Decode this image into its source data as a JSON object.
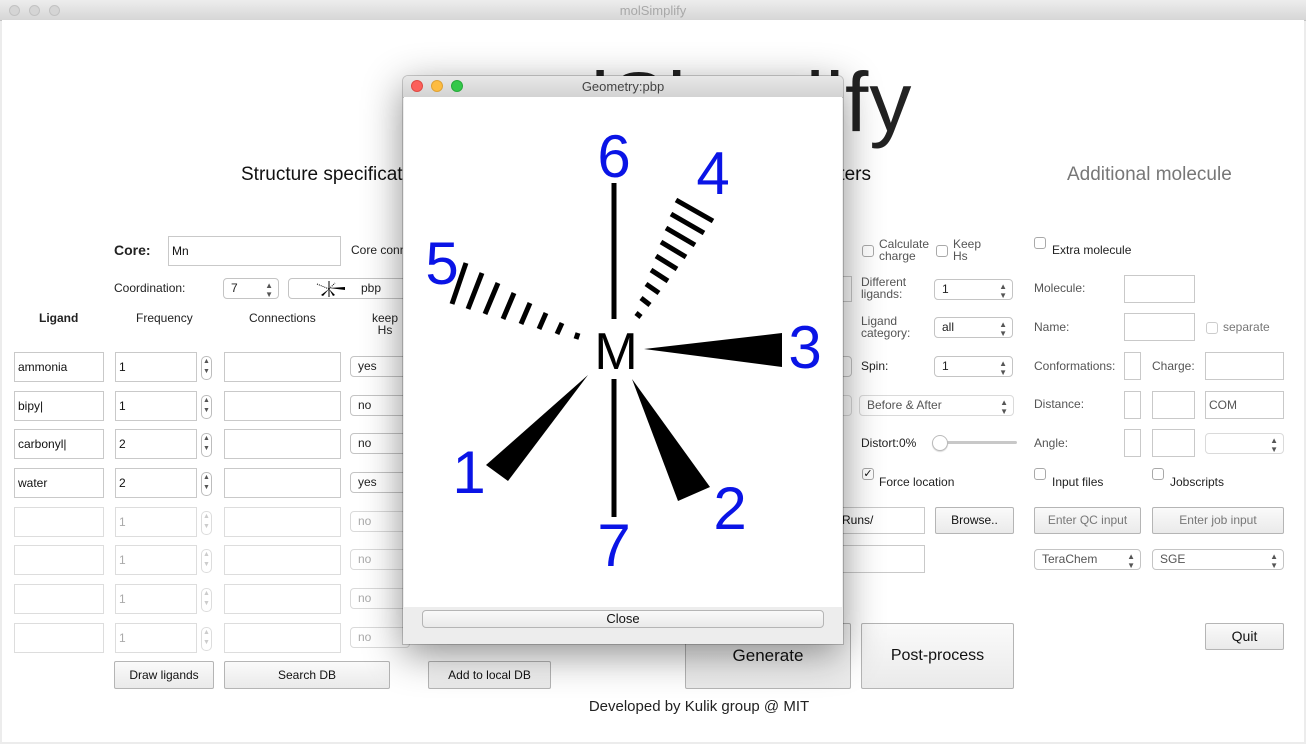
{
  "app": {
    "title": "molSimplify",
    "logo_text": "molSimplify"
  },
  "headings": {
    "structure": "Structure specification",
    "general": "General parameters",
    "additional": "Additional molecule"
  },
  "core": {
    "label": "Core:",
    "value": "Mn",
    "connection_label": "Core connection"
  },
  "coordination": {
    "label": "Coordination:",
    "value": "7",
    "geometry": "pbp"
  },
  "ligand_table": {
    "headers": {
      "ligand": "Ligand",
      "frequency": "Frequency",
      "connections": "Connections",
      "keep_hs": "keep Hs"
    },
    "rows": [
      {
        "ligand": "ammonia",
        "frequency": "1",
        "connections": "",
        "keep": "yes"
      },
      {
        "ligand": "bipy|",
        "frequency": "1",
        "connections": "",
        "keep": "no"
      },
      {
        "ligand": "carbonyl|",
        "frequency": "2",
        "connections": "",
        "keep": "no"
      },
      {
        "ligand": "water",
        "frequency": "2",
        "connections": "",
        "keep": "yes"
      },
      {
        "ligand": "",
        "frequency": "1",
        "connections": "",
        "keep": "no"
      },
      {
        "ligand": "",
        "frequency": "1",
        "connections": "",
        "keep": "no"
      },
      {
        "ligand": "",
        "frequency": "1",
        "connections": "",
        "keep": "no"
      },
      {
        "ligand": "",
        "frequency": "1",
        "connections": "",
        "keep": "no"
      }
    ]
  },
  "buttons": {
    "draw_ligands": "Draw ligands",
    "search_db": "Search DB",
    "add_local_db": "Add to local DB",
    "generate": "Generate",
    "post_process": "Post-process",
    "quit": "Quit",
    "browse": "Browse..",
    "enter_qc": "Enter QC input",
    "enter_job": "Enter job input"
  },
  "general": {
    "calc_charge": "Calculate charge",
    "keep_hs": "Keep Hs",
    "different_ligands_label": "Different ligands:",
    "different_ligands_value": "1",
    "ligand_category_label": "Ligand category:",
    "ligand_category_value": "all",
    "spin_label": "Spin:",
    "spin_value": "1",
    "ff_value": "Before & After",
    "distort_label": "Distort:0%",
    "distort_value": 0,
    "force_location": "Force location",
    "force_location_checked": true,
    "runs_path": "Runs/"
  },
  "additional": {
    "extra_molecule": "Extra molecule",
    "molecule_label": "Molecule:",
    "name_label": "Name:",
    "separate": "separate",
    "conformations_label": "Conformations:",
    "charge_label": "Charge:",
    "distance_label": "Distance:",
    "distance_ref": "COM",
    "angle_label": "Angle:",
    "input_files": "Input files",
    "jobscripts": "Jobscripts",
    "qc_code": "TeraChem",
    "scheduler": "SGE"
  },
  "footer": "Developed by Kulik group @ MIT",
  "dialog": {
    "title": "Geometry:pbp",
    "close_label": "Close",
    "center_atom": "M",
    "positions": [
      "1",
      "2",
      "3",
      "4",
      "5",
      "6",
      "7"
    ],
    "colors": {
      "number": "#0a14e6",
      "bond": "#000000"
    }
  },
  "colors": {
    "accent_red": "#fc605b",
    "accent_yellow": "#fdbc40",
    "accent_green": "#34c84a"
  }
}
